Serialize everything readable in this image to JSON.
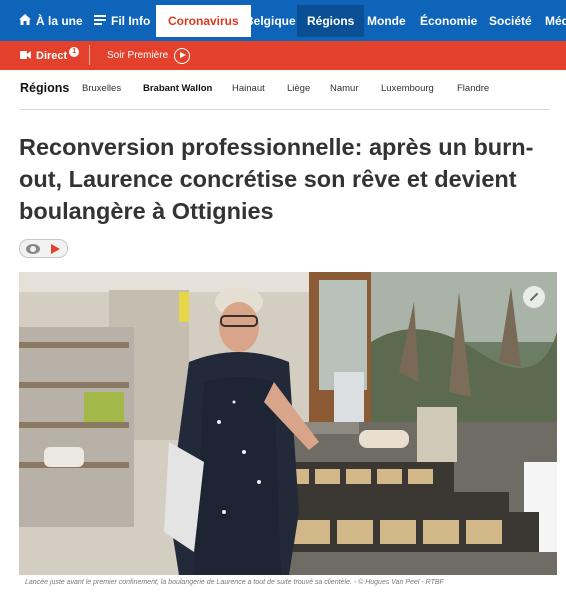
{
  "topnav": {
    "items": [
      {
        "label": "À la une",
        "icon": "home-icon"
      },
      {
        "label": "Fil Info",
        "icon": "list-icon"
      },
      {
        "label": "Coronavirus"
      },
      {
        "label": "Belgique"
      },
      {
        "label": "Régions"
      },
      {
        "label": "Monde"
      },
      {
        "label": "Économie"
      },
      {
        "label": "Société"
      },
      {
        "label": "Méd"
      }
    ]
  },
  "directbar": {
    "direct_label": "Direct",
    "direct_count": "1",
    "radio_label": "Soir Première"
  },
  "subnav": {
    "title": "Régions",
    "items": [
      "Bruxelles",
      "Brabant Wallon",
      "Hainaut",
      "Liège",
      "Namur",
      "Luxembourg",
      "Flandre"
    ]
  },
  "article": {
    "headline": "Reconversion professionnelle: après un burn-out, Laurence concrétise son rêve et devient boulangère à Ottignies",
    "caption": "Lancée juste avant le premier confinement, la boulangerie de Laurence a tout de suite trouvé sa clientèle. - © Hugues Van Peel - RTBF"
  },
  "colors": {
    "nav_blue": "#0d64b8",
    "nav_selected": "#0a4f93",
    "direct_red": "#e3412b"
  }
}
